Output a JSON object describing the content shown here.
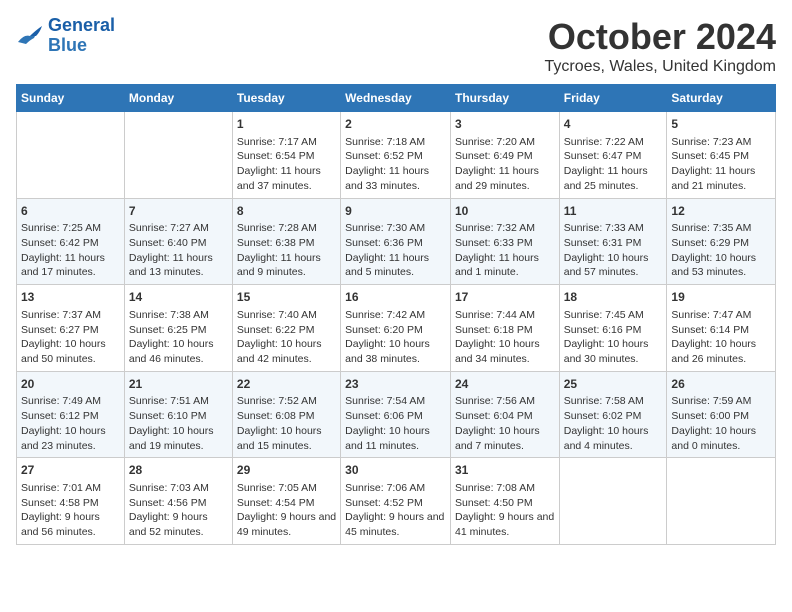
{
  "header": {
    "logo_general": "General",
    "logo_blue": "Blue",
    "month_title": "October 2024",
    "location": "Tycroes, Wales, United Kingdom"
  },
  "days_of_week": [
    "Sunday",
    "Monday",
    "Tuesday",
    "Wednesday",
    "Thursday",
    "Friday",
    "Saturday"
  ],
  "weeks": [
    {
      "days": [
        {
          "num": "",
          "info": ""
        },
        {
          "num": "",
          "info": ""
        },
        {
          "num": "1",
          "info": "Sunrise: 7:17 AM\nSunset: 6:54 PM\nDaylight: 11 hours and 37 minutes."
        },
        {
          "num": "2",
          "info": "Sunrise: 7:18 AM\nSunset: 6:52 PM\nDaylight: 11 hours and 33 minutes."
        },
        {
          "num": "3",
          "info": "Sunrise: 7:20 AM\nSunset: 6:49 PM\nDaylight: 11 hours and 29 minutes."
        },
        {
          "num": "4",
          "info": "Sunrise: 7:22 AM\nSunset: 6:47 PM\nDaylight: 11 hours and 25 minutes."
        },
        {
          "num": "5",
          "info": "Sunrise: 7:23 AM\nSunset: 6:45 PM\nDaylight: 11 hours and 21 minutes."
        }
      ]
    },
    {
      "days": [
        {
          "num": "6",
          "info": "Sunrise: 7:25 AM\nSunset: 6:42 PM\nDaylight: 11 hours and 17 minutes."
        },
        {
          "num": "7",
          "info": "Sunrise: 7:27 AM\nSunset: 6:40 PM\nDaylight: 11 hours and 13 minutes."
        },
        {
          "num": "8",
          "info": "Sunrise: 7:28 AM\nSunset: 6:38 PM\nDaylight: 11 hours and 9 minutes."
        },
        {
          "num": "9",
          "info": "Sunrise: 7:30 AM\nSunset: 6:36 PM\nDaylight: 11 hours and 5 minutes."
        },
        {
          "num": "10",
          "info": "Sunrise: 7:32 AM\nSunset: 6:33 PM\nDaylight: 11 hours and 1 minute."
        },
        {
          "num": "11",
          "info": "Sunrise: 7:33 AM\nSunset: 6:31 PM\nDaylight: 10 hours and 57 minutes."
        },
        {
          "num": "12",
          "info": "Sunrise: 7:35 AM\nSunset: 6:29 PM\nDaylight: 10 hours and 53 minutes."
        }
      ]
    },
    {
      "days": [
        {
          "num": "13",
          "info": "Sunrise: 7:37 AM\nSunset: 6:27 PM\nDaylight: 10 hours and 50 minutes."
        },
        {
          "num": "14",
          "info": "Sunrise: 7:38 AM\nSunset: 6:25 PM\nDaylight: 10 hours and 46 minutes."
        },
        {
          "num": "15",
          "info": "Sunrise: 7:40 AM\nSunset: 6:22 PM\nDaylight: 10 hours and 42 minutes."
        },
        {
          "num": "16",
          "info": "Sunrise: 7:42 AM\nSunset: 6:20 PM\nDaylight: 10 hours and 38 minutes."
        },
        {
          "num": "17",
          "info": "Sunrise: 7:44 AM\nSunset: 6:18 PM\nDaylight: 10 hours and 34 minutes."
        },
        {
          "num": "18",
          "info": "Sunrise: 7:45 AM\nSunset: 6:16 PM\nDaylight: 10 hours and 30 minutes."
        },
        {
          "num": "19",
          "info": "Sunrise: 7:47 AM\nSunset: 6:14 PM\nDaylight: 10 hours and 26 minutes."
        }
      ]
    },
    {
      "days": [
        {
          "num": "20",
          "info": "Sunrise: 7:49 AM\nSunset: 6:12 PM\nDaylight: 10 hours and 23 minutes."
        },
        {
          "num": "21",
          "info": "Sunrise: 7:51 AM\nSunset: 6:10 PM\nDaylight: 10 hours and 19 minutes."
        },
        {
          "num": "22",
          "info": "Sunrise: 7:52 AM\nSunset: 6:08 PM\nDaylight: 10 hours and 15 minutes."
        },
        {
          "num": "23",
          "info": "Sunrise: 7:54 AM\nSunset: 6:06 PM\nDaylight: 10 hours and 11 minutes."
        },
        {
          "num": "24",
          "info": "Sunrise: 7:56 AM\nSunset: 6:04 PM\nDaylight: 10 hours and 7 minutes."
        },
        {
          "num": "25",
          "info": "Sunrise: 7:58 AM\nSunset: 6:02 PM\nDaylight: 10 hours and 4 minutes."
        },
        {
          "num": "26",
          "info": "Sunrise: 7:59 AM\nSunset: 6:00 PM\nDaylight: 10 hours and 0 minutes."
        }
      ]
    },
    {
      "days": [
        {
          "num": "27",
          "info": "Sunrise: 7:01 AM\nSunset: 4:58 PM\nDaylight: 9 hours and 56 minutes."
        },
        {
          "num": "28",
          "info": "Sunrise: 7:03 AM\nSunset: 4:56 PM\nDaylight: 9 hours and 52 minutes."
        },
        {
          "num": "29",
          "info": "Sunrise: 7:05 AM\nSunset: 4:54 PM\nDaylight: 9 hours and 49 minutes."
        },
        {
          "num": "30",
          "info": "Sunrise: 7:06 AM\nSunset: 4:52 PM\nDaylight: 9 hours and 45 minutes."
        },
        {
          "num": "31",
          "info": "Sunrise: 7:08 AM\nSunset: 4:50 PM\nDaylight: 9 hours and 41 minutes."
        },
        {
          "num": "",
          "info": ""
        },
        {
          "num": "",
          "info": ""
        }
      ]
    }
  ]
}
